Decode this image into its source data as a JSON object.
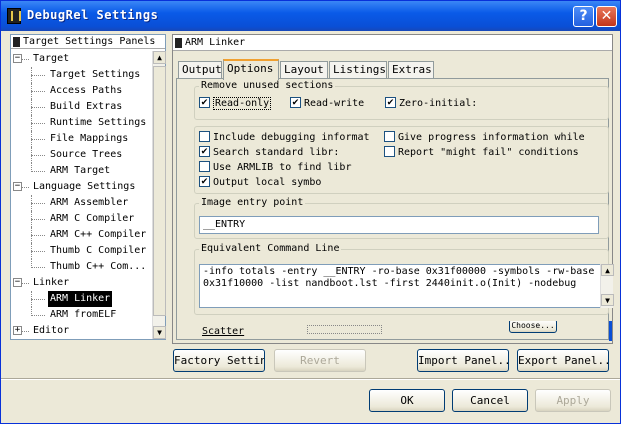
{
  "window": {
    "title": "DebugRel Settings",
    "help_glyph": "?",
    "close_glyph": "✕"
  },
  "tree": {
    "header": "Target Settings Panels",
    "items": [
      {
        "label": "Target",
        "level": 0,
        "expander": "−"
      },
      {
        "label": "Target Settings",
        "level": 1
      },
      {
        "label": "Access Paths",
        "level": 1
      },
      {
        "label": "Build Extras",
        "level": 1
      },
      {
        "label": "Runtime Settings",
        "level": 1
      },
      {
        "label": "File Mappings",
        "level": 1
      },
      {
        "label": "Source Trees",
        "level": 1
      },
      {
        "label": "ARM Target",
        "level": 1
      },
      {
        "label": "Language Settings",
        "level": 0,
        "expander": "−"
      },
      {
        "label": "ARM Assembler",
        "level": 1
      },
      {
        "label": "ARM C Compiler",
        "level": 1
      },
      {
        "label": "ARM C++ Compiler",
        "level": 1
      },
      {
        "label": "Thumb C Compiler",
        "level": 1
      },
      {
        "label": "Thumb C++ Com...",
        "level": 1
      },
      {
        "label": "Linker",
        "level": 0,
        "expander": "−"
      },
      {
        "label": "ARM Linker",
        "level": 1,
        "selected": true
      },
      {
        "label": "ARM fromELF",
        "level": 1
      },
      {
        "label": "Editor",
        "level": 0,
        "expander": "+"
      }
    ]
  },
  "panel": {
    "title": "ARM Linker",
    "tabs": [
      "Output",
      "Options",
      "Layout",
      "Listings",
      "Extras"
    ],
    "active_tab": "Options",
    "remove_unused": {
      "label": "Remove unused sections",
      "read_only": {
        "label": "Read-only",
        "checked": true
      },
      "read_write": {
        "label": "Read-write",
        "checked": true
      },
      "zero_initial": {
        "label": "Zero-initial:",
        "checked": true
      }
    },
    "options": {
      "include_debugging": {
        "label": "Include debugging informat",
        "checked": false
      },
      "search_standard": {
        "label": "Search standard libr:",
        "checked": true
      },
      "use_armlib": {
        "label": "Use ARMLIB to find libr",
        "checked": false
      },
      "output_local": {
        "label": "Output local symbo",
        "checked": true
      },
      "give_progress": {
        "label": "Give progress information while",
        "checked": false
      },
      "report_might_fail": {
        "label": "Report \"might fail\" conditions",
        "checked": false
      }
    },
    "entry_point": {
      "label": "Image entry point",
      "value": "__ENTRY"
    },
    "command_line": {
      "label": "Equivalent Command Line",
      "value": "-info totals -entry __ENTRY -ro-base 0x31f00000 -symbols -rw-base 0x31f10000 -list nandboot.lst -first 2440init.o(Init) -nodebug"
    },
    "peek": {
      "row_label": "Scatter",
      "button_fragment": "Choose..."
    }
  },
  "buttons": {
    "factory": "Factory Settings",
    "revert": "Revert",
    "import": "Import Panel...",
    "export": "Export Panel...",
    "ok": "OK",
    "cancel": "Cancel",
    "apply": "Apply"
  }
}
